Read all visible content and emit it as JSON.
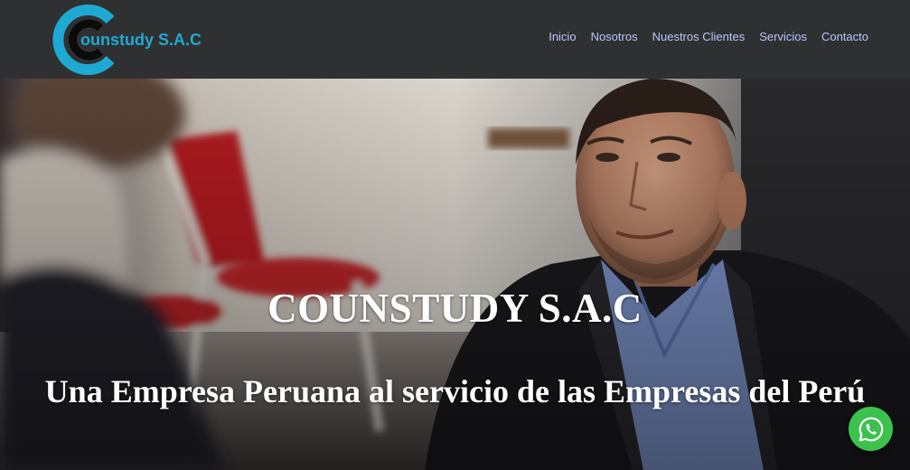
{
  "header": {
    "logo_text": "ounstudy S.A.C",
    "logo_colors": {
      "outer_ring": "#1ea9d2",
      "inner_ring": "#0b0b0b"
    },
    "nav": [
      {
        "label": "Inicio"
      },
      {
        "label": "Nosotros"
      },
      {
        "label": "Nuestros Clientes"
      },
      {
        "label": "Servicios"
      },
      {
        "label": "Contacto"
      }
    ],
    "nav_color": "#b9c7ff"
  },
  "hero": {
    "title": "COUNSTUDY S.A.C",
    "subtitle": "Una Empresa Peruana al servicio de las Empresas del Perú",
    "background": "photo of a smiling man in a dark blazer and blue shirt, blurred red chairs behind"
  },
  "whatsapp": {
    "icon": "whatsapp-icon",
    "color": "#3cc14f"
  }
}
